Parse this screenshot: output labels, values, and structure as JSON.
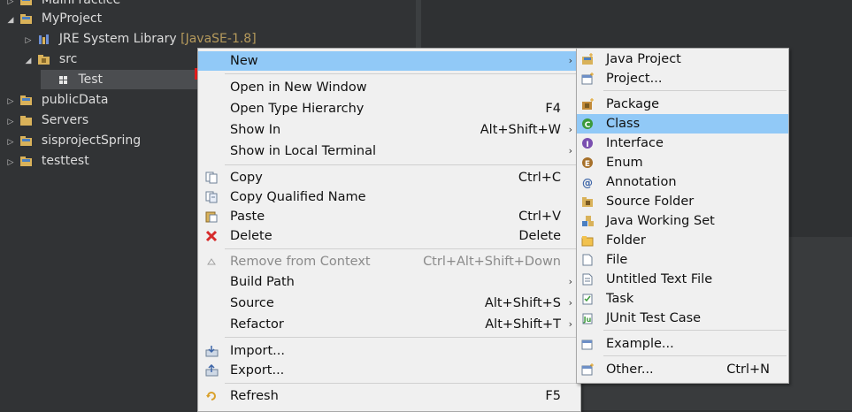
{
  "tree": {
    "items": [
      {
        "label": "MainPractice",
        "expanded": false,
        "icon": "project-icon"
      },
      {
        "label": "MyProject",
        "expanded": true,
        "icon": "project-icon"
      },
      {
        "label": "JRE System Library",
        "suffix": "[JavaSE-1.8]",
        "expanded": false,
        "icon": "library-icon"
      },
      {
        "label": "src",
        "expanded": true,
        "icon": "package-folder-icon"
      },
      {
        "label": "Test",
        "icon": "package-icon",
        "selected": true
      },
      {
        "label": "publicData",
        "expanded": false,
        "icon": "project-icon"
      },
      {
        "label": "Servers",
        "expanded": false,
        "icon": "folder-icon"
      },
      {
        "label": "sisprojectSpring",
        "expanded": false,
        "icon": "project-icon"
      },
      {
        "label": "testtest",
        "expanded": false,
        "icon": "project-icon"
      }
    ]
  },
  "context_menu": {
    "items": [
      {
        "label": "New",
        "shortcut": "",
        "submenu": true,
        "highlighted": true
      },
      {
        "label": "Open in New Window",
        "shortcut": ""
      },
      {
        "label": "Open Type Hierarchy",
        "shortcut": "F4"
      },
      {
        "label": "Show In",
        "shortcut": "Alt+Shift+W",
        "submenu": true
      },
      {
        "label": "Show in Local Terminal",
        "shortcut": "",
        "submenu": true
      },
      {
        "label": "Copy",
        "shortcut": "Ctrl+C",
        "icon": "copy-icon"
      },
      {
        "label": "Copy Qualified Name",
        "shortcut": "",
        "icon": "copy-qualified-icon"
      },
      {
        "label": "Paste",
        "shortcut": "Ctrl+V",
        "icon": "paste-icon"
      },
      {
        "label": "Delete",
        "shortcut": "Delete",
        "icon": "delete-icon"
      },
      {
        "label": "Remove from Context",
        "shortcut": "Ctrl+Alt+Shift+Down",
        "disabled": true,
        "icon": "remove-context-icon"
      },
      {
        "label": "Build Path",
        "shortcut": "",
        "submenu": true
      },
      {
        "label": "Source",
        "shortcut": "Alt+Shift+S",
        "submenu": true
      },
      {
        "label": "Refactor",
        "shortcut": "Alt+Shift+T",
        "submenu": true
      },
      {
        "label": "Import...",
        "shortcut": "",
        "icon": "import-icon"
      },
      {
        "label": "Export...",
        "shortcut": "",
        "icon": "export-icon"
      },
      {
        "label": "Refresh",
        "shortcut": "F5",
        "icon": "refresh-icon"
      }
    ]
  },
  "new_submenu": {
    "items": [
      {
        "label": "Java Project",
        "icon": "java-project-icon"
      },
      {
        "label": "Project...",
        "icon": "project-wizard-icon"
      },
      {
        "label": "Package",
        "icon": "package-icon"
      },
      {
        "label": "Class",
        "icon": "class-icon",
        "highlighted": true
      },
      {
        "label": "Interface",
        "icon": "interface-icon"
      },
      {
        "label": "Enum",
        "icon": "enum-icon"
      },
      {
        "label": "Annotation",
        "icon": "annotation-icon"
      },
      {
        "label": "Source Folder",
        "icon": "source-folder-icon"
      },
      {
        "label": "Java Working Set",
        "icon": "working-set-icon"
      },
      {
        "label": "Folder",
        "icon": "folder-icon"
      },
      {
        "label": "File",
        "icon": "file-icon"
      },
      {
        "label": "Untitled Text File",
        "icon": "text-file-icon"
      },
      {
        "label": "Task",
        "icon": "task-icon"
      },
      {
        "label": "JUnit Test Case",
        "icon": "junit-icon"
      },
      {
        "label": "Example...",
        "icon": "example-icon"
      },
      {
        "label": "Other...",
        "shortcut": "Ctrl+N",
        "icon": "other-icon"
      }
    ]
  },
  "colors": {
    "highlight": "#91c9f7",
    "menu_bg": "#f0f0f0",
    "tree_bg": "#313335",
    "marker": "#e01c1c"
  }
}
